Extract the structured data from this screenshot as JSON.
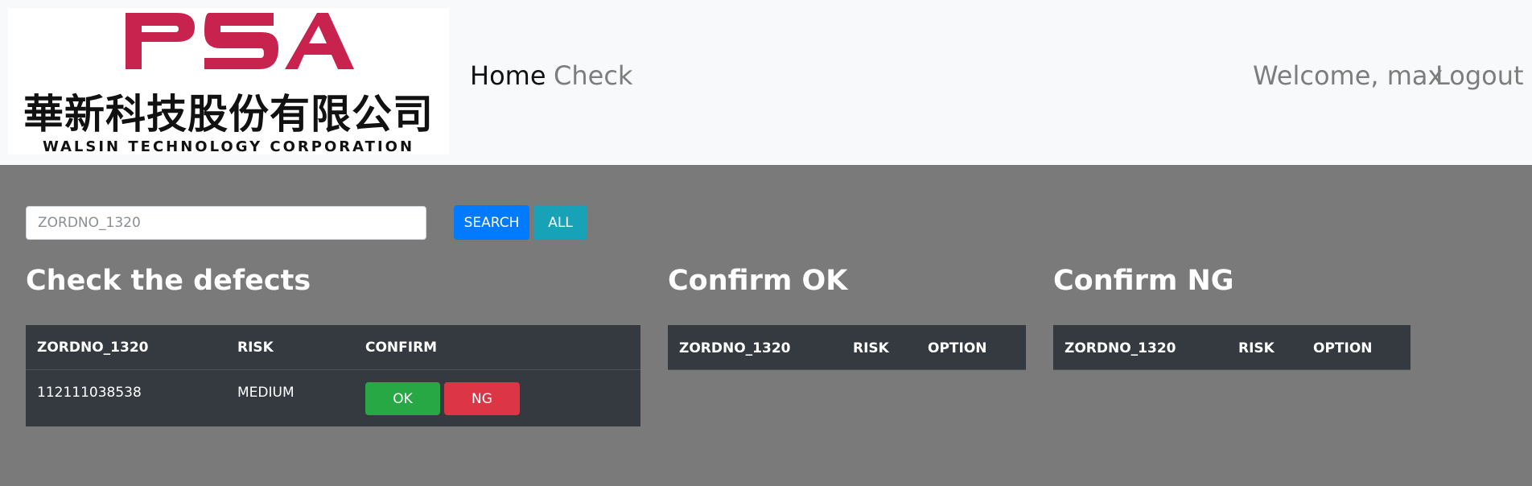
{
  "header": {
    "logo": {
      "brand": "PSA",
      "chinese_name": "華新科技股份有限公司",
      "english_name": "WALSIN TECHNOLOGY CORPORATION",
      "brand_color": "#c8224f"
    },
    "nav": {
      "home": "Home",
      "check": "Check"
    },
    "user": {
      "welcome": "Welcome, max",
      "logout": "Logout"
    }
  },
  "search": {
    "value": "",
    "placeholder": "ZORDNO_1320",
    "search_label": "SEARCH",
    "all_label": "ALL"
  },
  "defects": {
    "title": "Check the defects",
    "columns": [
      "ZORDNO_1320",
      "RISK",
      "CONFIRM"
    ],
    "rows": [
      {
        "zordno": "112111038538",
        "risk": "MEDIUM",
        "ok_label": "OK",
        "ng_label": "NG"
      }
    ]
  },
  "confirm_ok": {
    "title": "Confirm OK",
    "columns": [
      "ZORDNO_1320",
      "RISK",
      "OPTION"
    ]
  },
  "confirm_ng": {
    "title": "Confirm NG",
    "columns": [
      "ZORDNO_1320",
      "RISK",
      "OPTION"
    ]
  },
  "colors": {
    "background": "#7a7a7a",
    "navbar": "#f8f9fa",
    "table": "#343a40",
    "primary": "#007bff",
    "info": "#17a2b8",
    "success": "#28a745",
    "danger": "#dc3545"
  }
}
